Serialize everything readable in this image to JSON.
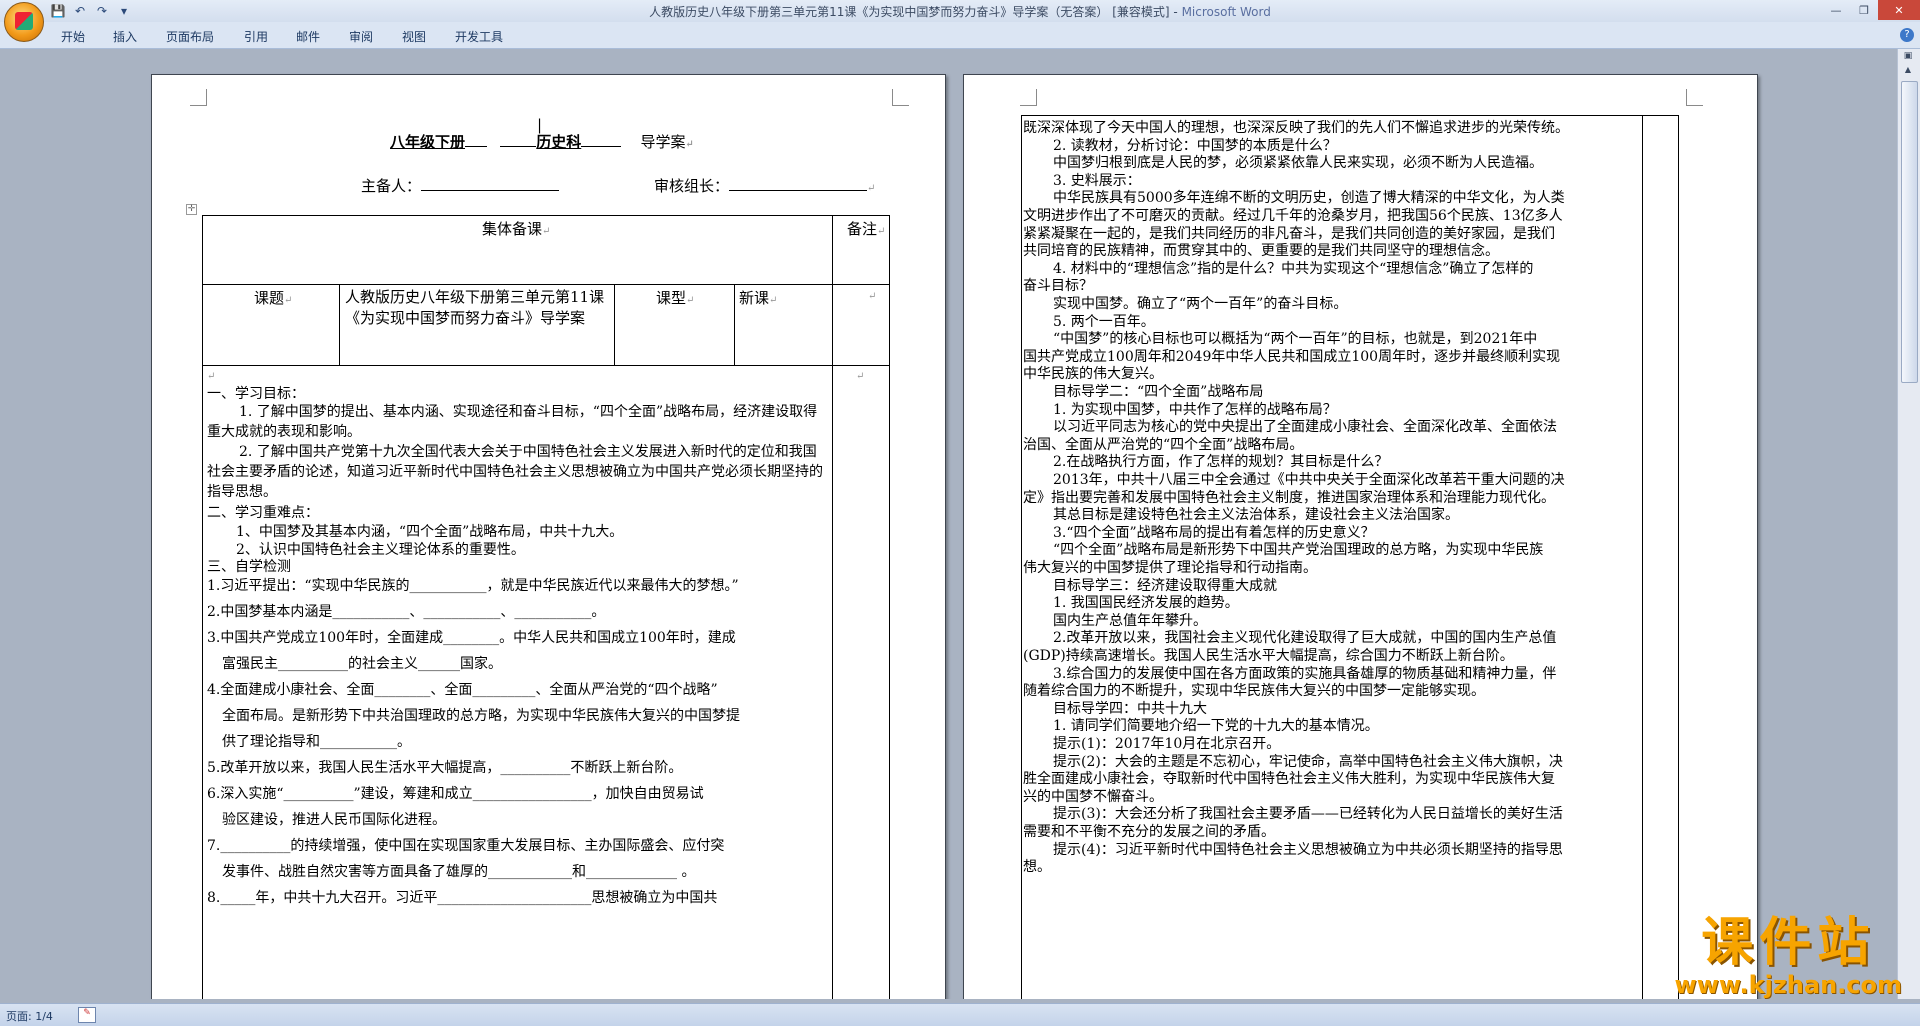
{
  "window": {
    "title": "人教版历史八年级下册第三单元第11课《为实现中国梦而努力奋斗》导学案（无答案） [兼容模式] - Microsoft Word",
    "title_doc": "人教版历史八年级下册第三单元第11课《为实现中国梦而努力奋斗》导学案（无答案） [兼容模式] -",
    "title_app": "Microsoft Word"
  },
  "ribbon": {
    "tabs": [
      "开始",
      "插入",
      "页面布局",
      "引用",
      "邮件",
      "审阅",
      "视图",
      "开发工具"
    ]
  },
  "status_bar": {
    "page": "页面: 1/4"
  },
  "watermark": {
    "title": "课件站",
    "url": "www.kjzhan.com"
  },
  "page1": {
    "header": {
      "grade": "八年级下册",
      "subject": "历史科",
      "doc_type": "导学案",
      "preparer_label": "主备人：",
      "reviewer_label": "审核组长："
    },
    "table": {
      "collective_label": "集体备课",
      "notes_label": "备注",
      "topic_label": "课题",
      "topic_value": "人教版历史八年级下册第三单元第11课《为实现中国梦而努力奋斗》导学案",
      "type_label": "课型",
      "type_value": "新课"
    },
    "body": [
      "一、学习目标：",
      "1. 了解中国梦的提出、基本内涵、实现途径和奋斗目标，“四个全面”战略布局，经济建设取得重大成就的表现和影响。",
      "2. 了解中国共产党第十九次全国代表大会关于中国特色社会主义发展进入新时代的定位和我国社会主要矛盾的论述，知道习近平新时代中国特色社会主义思想被确立为中国共产党必须长期坚持的指导思想。",
      "二、学习重难点：",
      "1、中国梦及其基本内涵，“四个全面”战略布局，中共十九大。",
      "2、认识中国特色社会主义理论体系的重要性。",
      "三、自学检测",
      "1.习近平提出：“实现中华民族的___________，就是中华民族近代以来最伟大的梦想。”",
      "2.中国梦基本内涵是___________、___________、___________。",
      "3.中国共产党成立100年时，全面建成________。中华人民共和国成立100年时，建成",
      "富强民主__________的社会主义______国家。",
      "4.全面建成小康社会、全面________、全面_________、全面从严治党的“四个战略”",
      "全面布局。是新形势下中共治国理政的总方略，为实现中华民族伟大复兴的中国梦提",
      "供了理论指导和___________。",
      "5.改革开放以来，我国人民生活水平大幅提高，__________不断跃上新台阶。",
      "6.深入实施“__________”建设，筹建和成立_________________，加快自由贸易试",
      "验区建设，推进人民币国际化进程。",
      "7.__________的持续增强，使中国在实现国家重大发展目标、主办国际盛会、应付突",
      "发事件、战胜自然灾害等方面具备了雄厚的____________和_____________ 。",
      "8._____年，中共十九大召开。习近平______________________思想被确立为中国共"
    ]
  },
  "page2": {
    "lines": [
      "既深深体现了今天中国人的理想，也深深反映了我们的先人们不懈追求进步的光荣传统。",
      "2. 读教材，分析讨论：中国梦的本质是什么？",
      "中国梦归根到底是人民的梦，必须紧紧依靠人民来实现，必须不断为人民造福。",
      "3. 史料展示：",
      "中华民族具有5000多年连绵不断的文明历史，创造了博大精深的中华文化，为人类",
      "文明进步作出了不可磨灭的贡献。经过几千年的沧桑岁月，把我国56个民族、13亿多人",
      "紧紧凝聚在一起的，是我们共同经历的非凡奋斗，是我们共同创造的美好家园，是我们",
      "共同培育的民族精神，而贯穿其中的、更重要的是我们共同坚守的理想信念。",
      "4. 材料中的“理想信念”指的是什么？中共为实现这个“理想信念”确立了怎样的",
      "奋斗目标？",
      "实现中国梦。确立了“两个一百年”的奋斗目标。",
      "5. 两个一百年。",
      "“中国梦”的核心目标也可以概括为“两个一百年”的目标，也就是，到2021年中",
      "国共产党成立100周年和2049年中华人民共和国成立100周年时，逐步并最终顺利实现",
      "中华民族的伟大复兴。",
      "目标导学二：“四个全面”战略布局",
      "1. 为实现中国梦，中共作了怎样的战略布局？",
      "以习近平同志为核心的党中央提出了全面建成小康社会、全面深化改革、全面依法",
      "治国、全面从严治党的“四个全面”战略布局。",
      "2.在战略执行方面，作了怎样的规划？其目标是什么？",
      "2013年，中共十八届三中全会通过《中共中央关于全面深化改革若干重大问题的决",
      "定》指出要完善和发展中国特色社会主义制度，推进国家治理体系和治理能力现代化。",
      "其总目标是建设特色社会主义法治体系，建设社会主义法治国家。",
      "3.“四个全面”战略布局的提出有着怎样的历史意义？",
      "“四个全面”战略布局是新形势下中国共产党治国理政的总方略，为实现中华民族",
      "伟大复兴的中国梦提供了理论指导和行动指南。",
      "目标导学三：经济建设取得重大成就",
      "1. 我国国民经济发展的趋势。",
      "国内生产总值年年攀升。",
      "2.改革开放以来，我国社会主义现代化建设取得了巨大成就，中国的国内生产总值",
      "(GDP)持续高速增长。我国人民生活水平大幅提高，综合国力不断跃上新台阶。",
      "3.综合国力的发展使中国在各方面政策的实施具备雄厚的物质基础和精神力量，伴",
      "随着综合国力的不断提升，实现中华民族伟大复兴的中国梦一定能够实现。",
      "目标导学四：中共十九大",
      "1. 请同学们简要地介绍一下党的十九大的基本情况。",
      "提示(1)：2017年10月在北京召开。",
      "提示(2)：大会的主题是不忘初心，牢记使命，高举中国特色社会主义伟大旗帜，决",
      "胜全面建成小康社会，夺取新时代中国特色社会主义伟大胜利，为实现中华民族伟大复",
      "兴的中国梦不懈奋斗。",
      "提示(3)：大会还分析了我国社会主要矛盾——已经转化为人民日益增长的美好生活",
      "需要和不平衡不充分的发展之间的矛盾。",
      "提示(4)：习近平新时代中国特色社会主义思想被确立为中共必须长期坚持的指导思",
      "想。"
    ]
  }
}
